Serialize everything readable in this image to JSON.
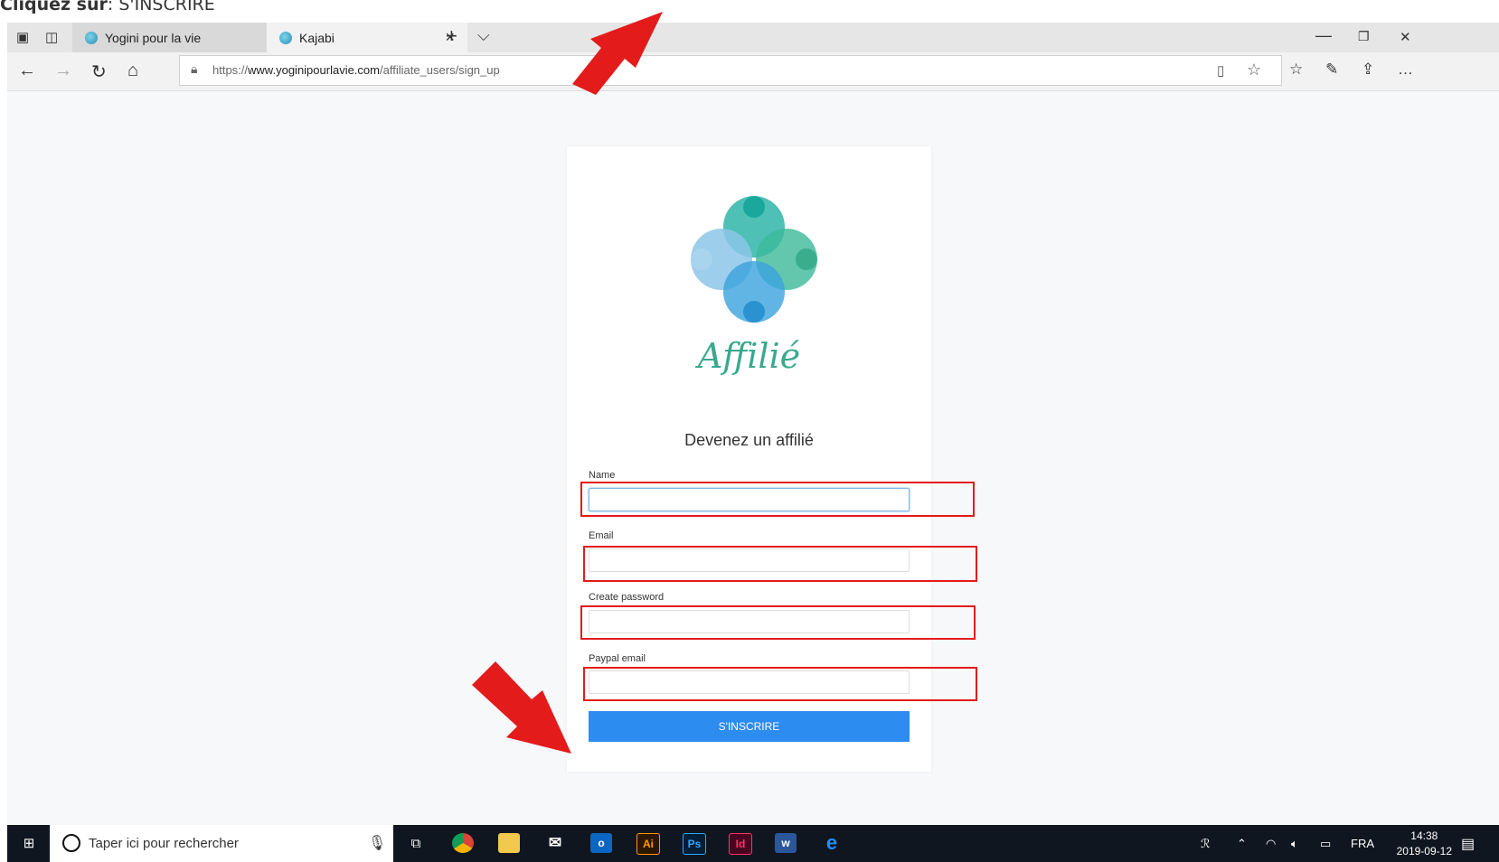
{
  "caption": {
    "prefix": "Cliquez sur",
    "rest": ": S'INSCRIRE"
  },
  "browser": {
    "tabs": [
      {
        "label": "Yogini pour la vie",
        "active": false
      },
      {
        "label": "Kajabi",
        "active": true
      }
    ],
    "tab_close": "×",
    "new_tab": "+",
    "tab_menu": "⌵",
    "window_controls": {
      "minimize": "—",
      "restore": "❐",
      "close": "✕"
    },
    "nav": {
      "back": "←",
      "forward": "→",
      "refresh": "↻",
      "home": "⌂"
    },
    "address": {
      "scheme": "https://",
      "host": "www.yoginipourlavie.com",
      "path": "/affiliate_users/sign_up"
    },
    "toolbar_icons": [
      "reading-view-icon",
      "favorite-star-icon",
      "favorites-list-icon",
      "pen-icon",
      "share-icon",
      "more-icon"
    ]
  },
  "form": {
    "brand": "Affilié",
    "heading": "Devenez un affilié",
    "fields": [
      {
        "label": "Name",
        "value": ""
      },
      {
        "label": "Email",
        "value": ""
      },
      {
        "label": "Create password",
        "value": ""
      },
      {
        "label": "Paypal email",
        "value": ""
      }
    ],
    "submit_label": "S'INSCRIRE"
  },
  "taskbar": {
    "search_placeholder": "Taper ici pour rechercher",
    "apps": [
      "chrome-icon",
      "file-explorer-icon",
      "mail-icon",
      "outlook-icon",
      "illustrator-icon",
      "photoshop-icon",
      "indesign-icon",
      "word-icon",
      "edge-icon"
    ],
    "app_labels": {
      "outlook": "o",
      "illustrator": "Ai",
      "photoshop": "Ps",
      "indesign": "Id",
      "word": "w"
    },
    "language": "FRA",
    "time": "14:38",
    "date": "2019-09-12"
  },
  "colors": {
    "primary_button": "#2d8cf0",
    "annotation_red": "#e31b1b",
    "brand_teal": "#3aa98e"
  }
}
